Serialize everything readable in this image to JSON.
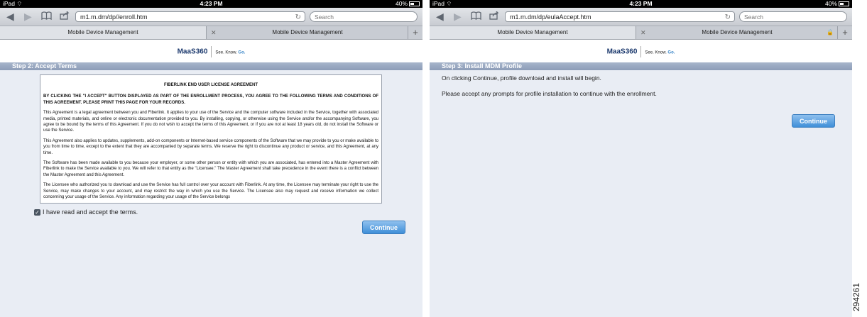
{
  "left": {
    "status": {
      "device": "iPad",
      "time": "4:23 PM",
      "battery": "40%"
    },
    "toolbar": {
      "url": "m1.m.dm/dp//enroll.htm",
      "search_placeholder": "Search"
    },
    "tabs": {
      "active": "Mobile Device Management",
      "inactive": "Mobile Device Management"
    },
    "logo": {
      "brand": "MaaS360",
      "tagline_a": "See. Know.",
      "tagline_b": "Go."
    },
    "step_title": "Step 2: Accept Terms",
    "eula": {
      "title": "FIBERLINK END USER LICENSE AGREEMENT",
      "paragraphs": [
        "BY CLICKING THE \"I ACCEPT\" BUTTON DISPLAYED AS PART OF THE ENROLLMENT PROCESS, YOU AGREE TO THE FOLLOWING TERMS AND CONDITIONS OF THIS AGREEMENT. PLEASE PRINT THIS PAGE FOR YOUR RECORDS.",
        "This Agreement is a legal agreement between you and Fiberlink. It applies to your use of the Service and the computer software included in the Service, together with associated media, printed materials, and online or electronic documentation provided to you. By installing, copying, or otherwise using the Service and/or the accompanying Software, you agree to be bound by the terms of this Agreement. If you do not wish to accept the terms of this Agreement, or if you are not at least 18 years old, do not install the Software or use the Service.",
        "This Agreement also applies to updates, supplements, add-on components or Internet-based service components of the Software that we may provide to you or make available to you from time to time, except to the extent that they are accompanied by separate terms. We reserve the right to discontinue any product or service, and this Agreement, at any time.",
        "The Software has been made available to you because your employer, or some other person or entity with which you are associated, has entered into a Master Agreement with Fiberlink to make the Service available to you. We will refer to that entity as the \"Licensee.\" The Master Agreement shall take precedence in the event there is a conflict between the Master Agreement and this Agreement.",
        "The Licensee who authorized you to download and use the Service has full control over your account with Fiberlink. At any time, the Licensee may terminate your right to use the Service, may make changes to your account, and may restrict the way in which you use the Service. The Licensee also may request and receive information we collect concerning your usage of the Service. Any information regarding your usage of the Service belongs"
      ]
    },
    "agree_label": "I have read and accept the terms.",
    "continue_label": "Continue"
  },
  "right": {
    "status": {
      "device": "iPad",
      "time": "4:23 PM",
      "battery": "40%"
    },
    "toolbar": {
      "url": "m1.m.dm/dp/eulaAccept.htm",
      "search_placeholder": "Search"
    },
    "tabs": {
      "active": "Mobile Device Management",
      "inactive": "Mobile Device Management"
    },
    "logo": {
      "brand": "MaaS360",
      "tagline_a": "See. Know.",
      "tagline_b": "Go."
    },
    "step_title": "Step 3: Install MDM Profile",
    "message_1": "On clicking Continue, profile download and install will begin.",
    "message_2": "Please accept any prompts for profile installation to continue with the enrollment.",
    "continue_label": "Continue"
  },
  "figure_number": "294261"
}
